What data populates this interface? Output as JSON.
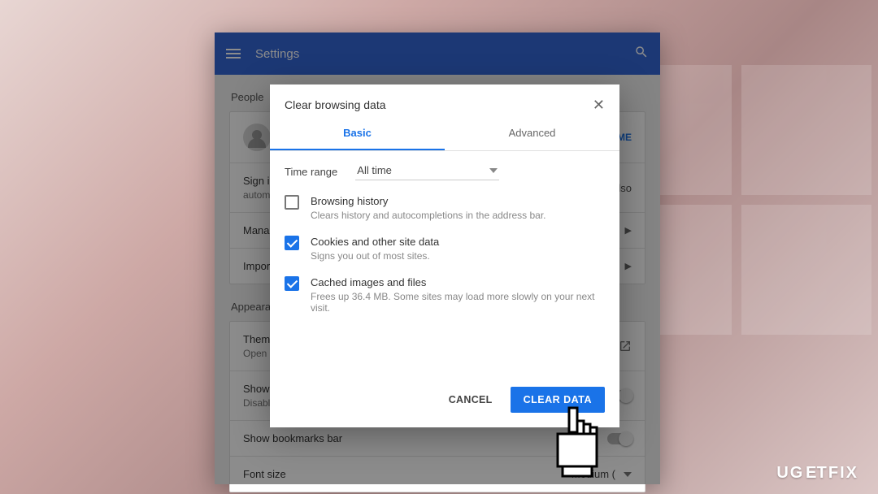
{
  "appbar": {
    "title": "Settings"
  },
  "people": {
    "section_label": "People",
    "signin_hint_line1": "Sign in",
    "signin_hint_line2": "automa",
    "signin_button": "SIGN IN TO CHROME",
    "signin_suffix": "lso",
    "manage_label": "Manage",
    "import_label": "Import"
  },
  "appearance": {
    "section_label": "Appearance",
    "theme_label": "Themes",
    "theme_sub": "Open C",
    "show_home_label": "Show h",
    "show_home_sub": "Disable",
    "bookmarks_label": "Show bookmarks bar",
    "font_label": "Font size",
    "font_value": "Medium ("
  },
  "dialog": {
    "title": "Clear browsing data",
    "tabs": {
      "basic": "Basic",
      "advanced": "Advanced"
    },
    "time_range_label": "Time range",
    "time_range_value": "All time",
    "options": [
      {
        "checked": false,
        "title": "Browsing history",
        "desc": "Clears history and autocompletions in the address bar."
      },
      {
        "checked": true,
        "title": "Cookies and other site data",
        "desc": "Signs you out of most sites."
      },
      {
        "checked": true,
        "title": "Cached images and files",
        "desc": "Frees up 36.4 MB. Some sites may load more slowly on your next visit."
      }
    ],
    "cancel": "CANCEL",
    "confirm": "CLEAR DATA"
  },
  "watermark": "UG⟃TFIX"
}
